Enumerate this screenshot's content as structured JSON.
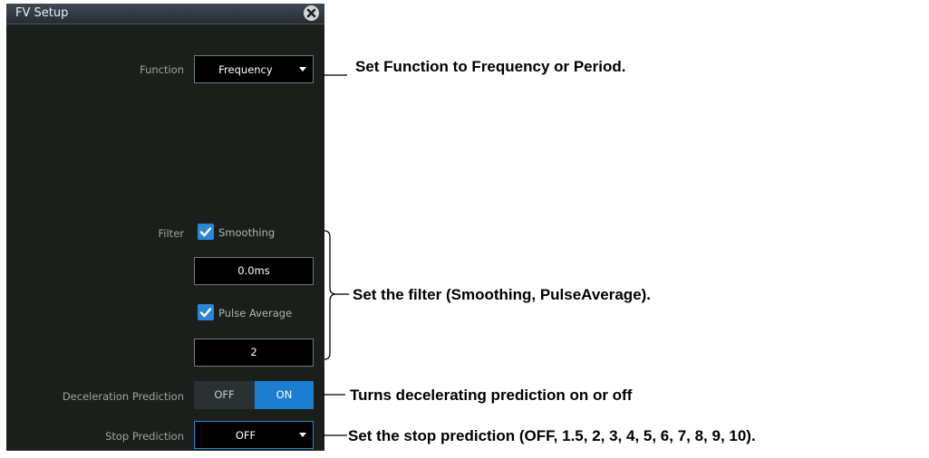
{
  "dialog": {
    "title": "FV Setup",
    "close_icon": "close-circle-icon"
  },
  "function": {
    "label": "Function",
    "value": "Frequency"
  },
  "filter": {
    "label": "Filter",
    "smoothing_label": "Smoothing",
    "smoothing_checked": true,
    "smoothing_value": "0.0ms",
    "pulse_average_label": "Pulse Average",
    "pulse_average_checked": true,
    "pulse_average_value": "2"
  },
  "deceleration_prediction": {
    "label": "Deceleration Prediction",
    "off_label": "OFF",
    "on_label": "ON",
    "selected": "ON"
  },
  "stop_prediction": {
    "label": "Stop Prediction",
    "value": "OFF"
  },
  "annotations": {
    "function": "Set Function to Frequency or Period.",
    "filter": "Set the filter (Smoothing, PulseAverage).",
    "deceleration": "Turns decelerating prediction on or off",
    "stop": "Set the stop prediction (OFF, 1.5, 2, 3, 4, 5, 6, 7, 8, 9, 10)."
  },
  "colors": {
    "panel_bg": "#1b1f1a",
    "accent": "#1b7ed0",
    "title_bar": "#3d4a55"
  }
}
